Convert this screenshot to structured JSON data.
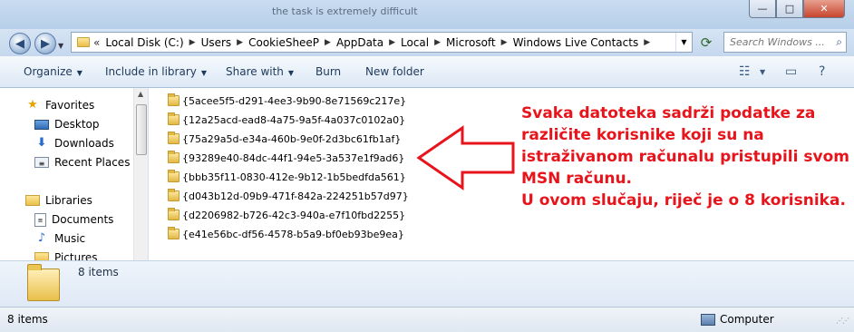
{
  "titlebar": {
    "ghost_text": "the task is extremely difficult",
    "minimize": "—",
    "maximize": "□",
    "close": "✕"
  },
  "address": {
    "overflow": "«",
    "crumbs": [
      "Local Disk (C:)",
      "Users",
      "CookieSheeP",
      "AppData",
      "Local",
      "Microsoft",
      "Windows Live Contacts"
    ]
  },
  "search": {
    "placeholder": "Search Windows ..."
  },
  "toolbar": {
    "organize": "Organize",
    "include_library": "Include in library",
    "share_with": "Share with",
    "burn": "Burn",
    "new_folder": "New folder"
  },
  "navpane": {
    "favorites": "Favorites",
    "desktop": "Desktop",
    "downloads": "Downloads",
    "recent": "Recent Places",
    "libraries": "Libraries",
    "documents": "Documents",
    "music": "Music",
    "pictures": "Pictures"
  },
  "files": [
    "{5acee5f5-d291-4ee3-9b90-8e71569c217e}",
    "{12a25acd-ead8-4a75-9a5f-4a037c0102a0}",
    "{75a29a5d-e34a-460b-9e0f-2d3bc61fb1af}",
    "{93289e40-84dc-44f1-94e5-3a537e1f9ad6}",
    "{bbb35f11-0830-412e-9b12-1b5bedfda561}",
    "{d043b12d-09b9-471f-842a-224251b57d97}",
    "{d2206982-b726-42c3-940a-e7f10fbd2255}",
    "{e41e56bc-df56-4578-b5a9-bf0eb93be9ea}"
  ],
  "annotation": {
    "lines": [
      "Svaka datoteka sadrži podatke za",
      "različite korisnike koji su na",
      "istraživanom računalu pristupili svom",
      "MSN računu.",
      "U ovom slučaju, riječ je o 8 korisnika."
    ],
    "color": "#e8141c"
  },
  "details": {
    "count": "8 items"
  },
  "status": {
    "items": "8 items",
    "location": "Computer"
  }
}
